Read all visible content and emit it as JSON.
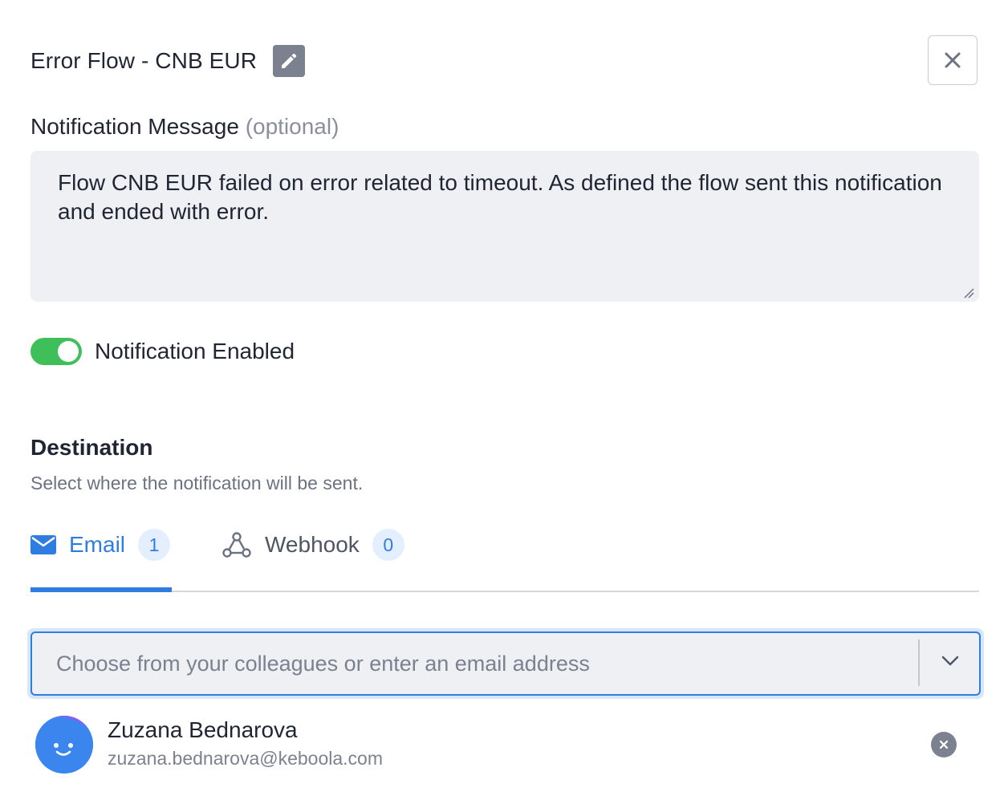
{
  "header": {
    "title": "Error Flow - CNB EUR",
    "edit_icon": "pencil-icon",
    "close_icon": "close-icon"
  },
  "message": {
    "label": "Notification Message",
    "optional": "(optional)",
    "value": "Flow CNB EUR failed on error related to timeout. As defined the flow sent this notification and ended with error."
  },
  "toggle": {
    "label": "Notification Enabled",
    "enabled": true,
    "color": "#3fbf5a"
  },
  "destination": {
    "title": "Destination",
    "description": "Select where the notification will be sent.",
    "tabs": [
      {
        "label": "Email",
        "count": "1",
        "icon": "envelope-icon",
        "active": true
      },
      {
        "label": "Webhook",
        "count": "0",
        "icon": "webhook-icon",
        "active": false
      }
    ],
    "accent": "#2f7de0"
  },
  "recipient_select": {
    "placeholder": "Choose from your colleagues or enter an email address"
  },
  "recipients": [
    {
      "name": "Zuzana Bednarova",
      "email": "zuzana.bednarova@keboola.com"
    }
  ]
}
